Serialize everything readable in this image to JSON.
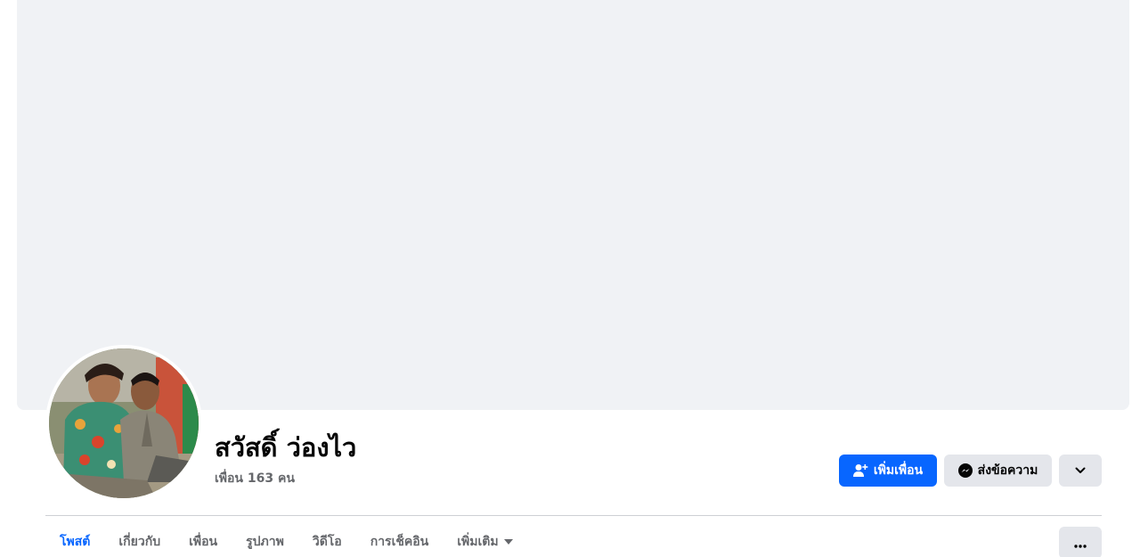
{
  "profile": {
    "name": "สวัสดิ์ ว่องไว",
    "friends_count": "เพื่อน 163 คน",
    "avatar_icon": "profile-photo-couple"
  },
  "actions": {
    "add_friend_label": "เพิ่มเพื่อน",
    "add_friend_icon": "add-friend-icon",
    "message_label": "ส่งข้อความ",
    "message_icon": "messenger-icon",
    "more_icon": "chevron-down-icon"
  },
  "tabs": [
    {
      "label": "โพสต์",
      "active": true
    },
    {
      "label": "เกี่ยวกับ",
      "active": false
    },
    {
      "label": "เพื่อน",
      "active": false
    },
    {
      "label": "รูปภาพ",
      "active": false
    },
    {
      "label": "วิดีโอ",
      "active": false
    },
    {
      "label": "การเช็คอิน",
      "active": false
    },
    {
      "label": "เพิ่มเติม",
      "active": false,
      "dropdown": true
    }
  ],
  "tab_overflow_icon": "ellipsis-icon",
  "colors": {
    "accent": "#0866ff",
    "cover_bg": "#f0f2f5",
    "button_gray": "#e4e6eb",
    "secondary_text": "#65676b"
  }
}
